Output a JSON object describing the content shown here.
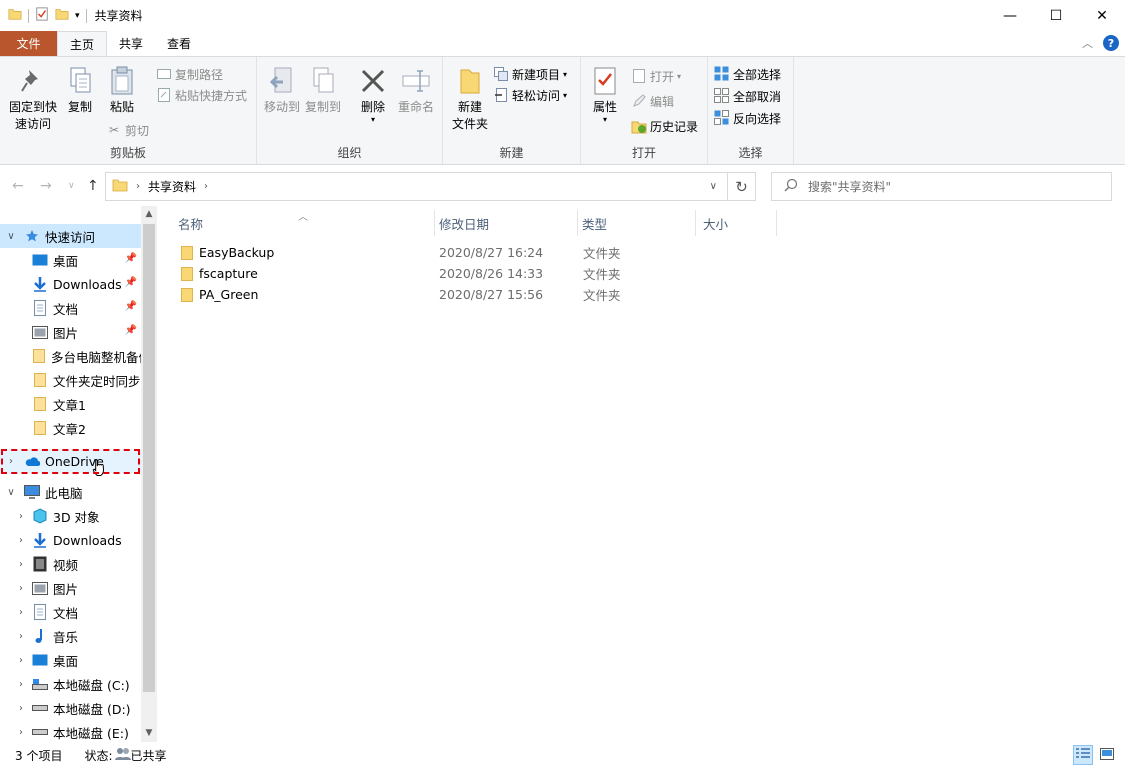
{
  "window": {
    "title": "共享资料",
    "minimize": "—",
    "maximize": "☐",
    "close": "✕"
  },
  "ribbon_tabs": [
    "文件",
    "主页",
    "共享",
    "查看"
  ],
  "ribbon": {
    "clipboard": {
      "label": "剪贴板",
      "pin_line1": "固定到快",
      "pin_line2": "速访问",
      "copy": "复制",
      "paste": "粘贴",
      "copy_path": "复制路径",
      "paste_shortcut": "粘贴快捷方式",
      "cut": "剪切"
    },
    "organize": {
      "label": "组织",
      "move_to": "移动到",
      "copy_to": "复制到",
      "delete": "删除",
      "rename": "重命名"
    },
    "new": {
      "label": "新建",
      "new_folder_line1": "新建",
      "new_folder_line2": "文件夹",
      "new_item": "新建项目",
      "easy_access": "轻松访问"
    },
    "open": {
      "label": "打开",
      "properties": "属性",
      "open": "打开",
      "edit": "编辑",
      "history": "历史记录"
    },
    "select": {
      "label": "选择",
      "select_all": "全部选择",
      "select_none": "全部取消",
      "invert": "反向选择"
    }
  },
  "address": {
    "path": "共享资料",
    "search_placeholder": "搜索\"共享资料\""
  },
  "nav": {
    "quick_access": "快速访问",
    "qa_items": [
      "桌面",
      "Downloads",
      "文档",
      "图片",
      "多台电脑整机备份",
      "文件夹定时同步",
      "文章1",
      "文章2"
    ],
    "onedrive": "OneDrive",
    "this_pc": "此电脑",
    "pc_items": [
      "3D 对象",
      "Downloads",
      "视频",
      "图片",
      "文档",
      "音乐",
      "桌面",
      "本地磁盘 (C:)",
      "本地磁盘 (D:)",
      "本地磁盘 (E:)"
    ]
  },
  "columns": [
    "名称",
    "修改日期",
    "类型",
    "大小"
  ],
  "files": [
    {
      "name": "EasyBackup",
      "date": "2020/8/27 16:24",
      "type": "文件夹"
    },
    {
      "name": "fscapture",
      "date": "2020/8/26 14:33",
      "type": "文件夹"
    },
    {
      "name": "PA_Green",
      "date": "2020/8/27 15:56",
      "type": "文件夹"
    }
  ],
  "status": {
    "count": "3 个项目",
    "state_label": "状态:",
    "state_value": "已共享"
  },
  "colors": {
    "file_tab": "#b9562d",
    "folder": "#f8d775",
    "accent": "#1a66c7",
    "highlight": "#e0000b"
  }
}
